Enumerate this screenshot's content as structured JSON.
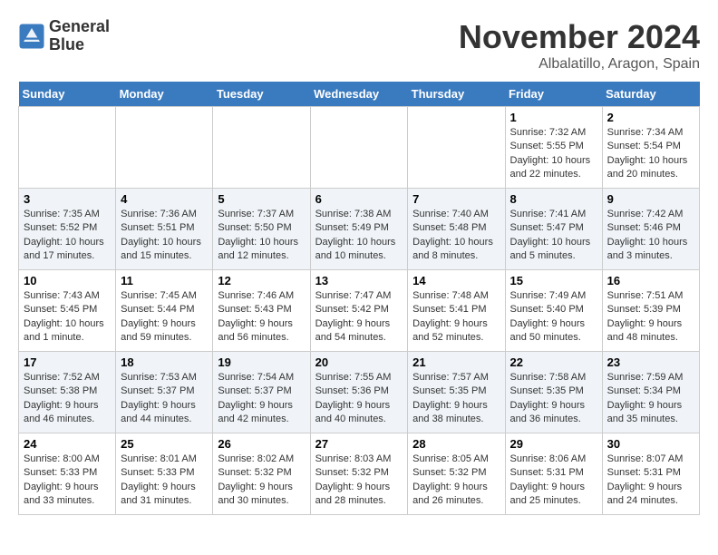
{
  "header": {
    "logo_line1": "General",
    "logo_line2": "Blue",
    "month": "November 2024",
    "location": "Albalatillo, Aragon, Spain"
  },
  "weekdays": [
    "Sunday",
    "Monday",
    "Tuesday",
    "Wednesday",
    "Thursday",
    "Friday",
    "Saturday"
  ],
  "weeks": [
    [
      {
        "day": "",
        "info": ""
      },
      {
        "day": "",
        "info": ""
      },
      {
        "day": "",
        "info": ""
      },
      {
        "day": "",
        "info": ""
      },
      {
        "day": "",
        "info": ""
      },
      {
        "day": "1",
        "info": "Sunrise: 7:32 AM\nSunset: 5:55 PM\nDaylight: 10 hours and 22 minutes."
      },
      {
        "day": "2",
        "info": "Sunrise: 7:34 AM\nSunset: 5:54 PM\nDaylight: 10 hours and 20 minutes."
      }
    ],
    [
      {
        "day": "3",
        "info": "Sunrise: 7:35 AM\nSunset: 5:52 PM\nDaylight: 10 hours and 17 minutes."
      },
      {
        "day": "4",
        "info": "Sunrise: 7:36 AM\nSunset: 5:51 PM\nDaylight: 10 hours and 15 minutes."
      },
      {
        "day": "5",
        "info": "Sunrise: 7:37 AM\nSunset: 5:50 PM\nDaylight: 10 hours and 12 minutes."
      },
      {
        "day": "6",
        "info": "Sunrise: 7:38 AM\nSunset: 5:49 PM\nDaylight: 10 hours and 10 minutes."
      },
      {
        "day": "7",
        "info": "Sunrise: 7:40 AM\nSunset: 5:48 PM\nDaylight: 10 hours and 8 minutes."
      },
      {
        "day": "8",
        "info": "Sunrise: 7:41 AM\nSunset: 5:47 PM\nDaylight: 10 hours and 5 minutes."
      },
      {
        "day": "9",
        "info": "Sunrise: 7:42 AM\nSunset: 5:46 PM\nDaylight: 10 hours and 3 minutes."
      }
    ],
    [
      {
        "day": "10",
        "info": "Sunrise: 7:43 AM\nSunset: 5:45 PM\nDaylight: 10 hours and 1 minute."
      },
      {
        "day": "11",
        "info": "Sunrise: 7:45 AM\nSunset: 5:44 PM\nDaylight: 9 hours and 59 minutes."
      },
      {
        "day": "12",
        "info": "Sunrise: 7:46 AM\nSunset: 5:43 PM\nDaylight: 9 hours and 56 minutes."
      },
      {
        "day": "13",
        "info": "Sunrise: 7:47 AM\nSunset: 5:42 PM\nDaylight: 9 hours and 54 minutes."
      },
      {
        "day": "14",
        "info": "Sunrise: 7:48 AM\nSunset: 5:41 PM\nDaylight: 9 hours and 52 minutes."
      },
      {
        "day": "15",
        "info": "Sunrise: 7:49 AM\nSunset: 5:40 PM\nDaylight: 9 hours and 50 minutes."
      },
      {
        "day": "16",
        "info": "Sunrise: 7:51 AM\nSunset: 5:39 PM\nDaylight: 9 hours and 48 minutes."
      }
    ],
    [
      {
        "day": "17",
        "info": "Sunrise: 7:52 AM\nSunset: 5:38 PM\nDaylight: 9 hours and 46 minutes."
      },
      {
        "day": "18",
        "info": "Sunrise: 7:53 AM\nSunset: 5:37 PM\nDaylight: 9 hours and 44 minutes."
      },
      {
        "day": "19",
        "info": "Sunrise: 7:54 AM\nSunset: 5:37 PM\nDaylight: 9 hours and 42 minutes."
      },
      {
        "day": "20",
        "info": "Sunrise: 7:55 AM\nSunset: 5:36 PM\nDaylight: 9 hours and 40 minutes."
      },
      {
        "day": "21",
        "info": "Sunrise: 7:57 AM\nSunset: 5:35 PM\nDaylight: 9 hours and 38 minutes."
      },
      {
        "day": "22",
        "info": "Sunrise: 7:58 AM\nSunset: 5:35 PM\nDaylight: 9 hours and 36 minutes."
      },
      {
        "day": "23",
        "info": "Sunrise: 7:59 AM\nSunset: 5:34 PM\nDaylight: 9 hours and 35 minutes."
      }
    ],
    [
      {
        "day": "24",
        "info": "Sunrise: 8:00 AM\nSunset: 5:33 PM\nDaylight: 9 hours and 33 minutes."
      },
      {
        "day": "25",
        "info": "Sunrise: 8:01 AM\nSunset: 5:33 PM\nDaylight: 9 hours and 31 minutes."
      },
      {
        "day": "26",
        "info": "Sunrise: 8:02 AM\nSunset: 5:32 PM\nDaylight: 9 hours and 30 minutes."
      },
      {
        "day": "27",
        "info": "Sunrise: 8:03 AM\nSunset: 5:32 PM\nDaylight: 9 hours and 28 minutes."
      },
      {
        "day": "28",
        "info": "Sunrise: 8:05 AM\nSunset: 5:32 PM\nDaylight: 9 hours and 26 minutes."
      },
      {
        "day": "29",
        "info": "Sunrise: 8:06 AM\nSunset: 5:31 PM\nDaylight: 9 hours and 25 minutes."
      },
      {
        "day": "30",
        "info": "Sunrise: 8:07 AM\nSunset: 5:31 PM\nDaylight: 9 hours and 24 minutes."
      }
    ]
  ]
}
